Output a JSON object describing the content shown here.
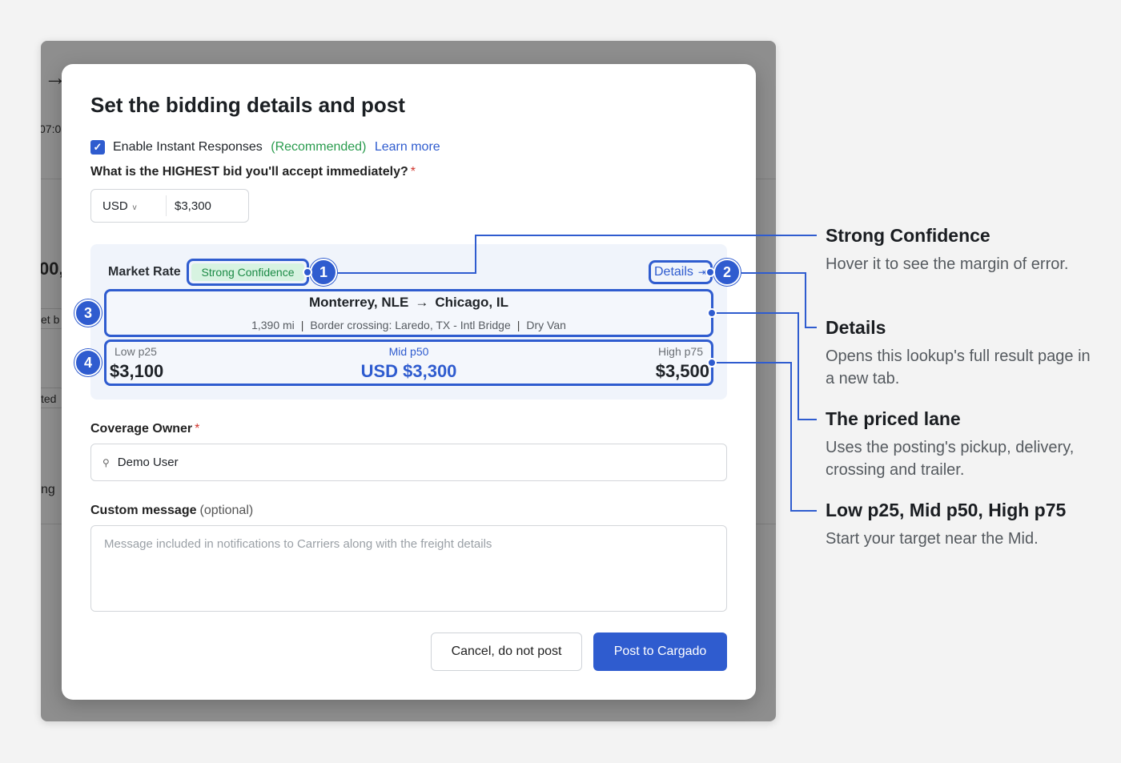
{
  "background": {
    "fragments": [
      "→",
      "07:0",
      "00,",
      "et b",
      "ted",
      "ng"
    ]
  },
  "modal": {
    "title": "Set the bidding details and post",
    "instant": {
      "label": "Enable Instant Responses",
      "recommended": "(Recommended)",
      "learn_more": "Learn more",
      "checked": true
    },
    "highest_bid": {
      "label": "What is the HIGHEST bid you'll accept immediately?",
      "required_mark": "*",
      "currency": "USD",
      "currency_chevron": "v",
      "amount": "$3,300"
    },
    "market_rate": {
      "label": "Market Rate",
      "confidence": "Strong Confidence",
      "details": "Details",
      "details_icon": "external-link-icon",
      "lane": {
        "origin": "Monterrey, NLE",
        "destination": "Chicago, IL",
        "arrow": "→",
        "distance": "1,390 mi",
        "crossing": "Border crossing: Laredo, TX - Intl Bridge",
        "trailer": "Dry Van"
      },
      "range": {
        "low_label": "Low p25",
        "low_value": "$3,100",
        "mid_label": "Mid p50",
        "mid_value": "USD $3,300",
        "high_label": "High p75",
        "high_value": "$3,500"
      }
    },
    "coverage_owner": {
      "label": "Coverage Owner",
      "required_mark": "*",
      "value": "Demo User",
      "icon": "search-icon"
    },
    "custom_message": {
      "label": "Custom message",
      "optional": "(optional)",
      "placeholder": "Message included in notifications to Carriers along with the freight details"
    },
    "buttons": {
      "cancel": "Cancel, do not post",
      "post": "Post to Cargado"
    }
  },
  "markers": [
    "1",
    "2",
    "3",
    "4"
  ],
  "annotations": [
    {
      "title": "Strong Confidence",
      "body": "Hover it to see the margin of error."
    },
    {
      "title": "Details",
      "body": "Opens this lookup's full result page in a new tab."
    },
    {
      "title": "The priced lane",
      "body": "Uses the posting's pickup, delivery, crossing and trailer."
    },
    {
      "title": "Low p25, Mid p50, High p75",
      "body": "Start your target near the Mid."
    }
  ],
  "colors": {
    "accent": "#2f5ccf",
    "confidence_bg": "#d7f3e1",
    "confidence_text": "#1b8a45",
    "recommended": "#2a9c4e",
    "required": "#d0342c"
  }
}
